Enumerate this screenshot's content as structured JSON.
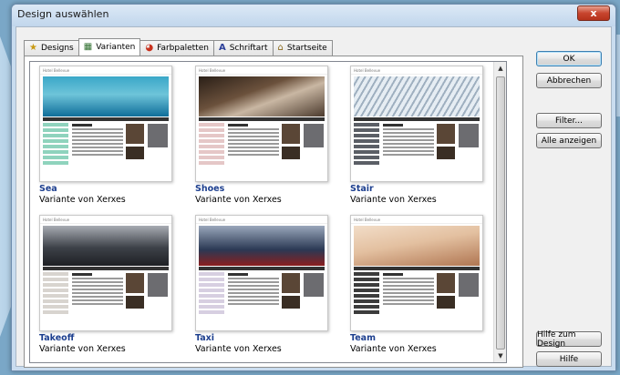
{
  "window": {
    "title": "Design auswählen",
    "close_label": "x"
  },
  "tabs": [
    {
      "label": "Designs",
      "icon": "star-icon",
      "glyph": "★"
    },
    {
      "label": "Varianten",
      "icon": "grid-icon",
      "glyph": "▦"
    },
    {
      "label": "Farbpaletten",
      "icon": "palette-icon",
      "glyph": "◕"
    },
    {
      "label": "Schriftart",
      "icon": "font-icon",
      "glyph": "A"
    },
    {
      "label": "Startseite",
      "icon": "home-icon",
      "glyph": "⌂"
    }
  ],
  "active_tab": "Varianten",
  "variants": [
    {
      "name": "Sea",
      "subtitle": "Variante von Xerxes",
      "header_text": "Hotel Bellevue",
      "hero_color": "#3aa7c8",
      "hero_color2": "#0e6d99",
      "side_color": "#8fd3bd"
    },
    {
      "name": "Shoes",
      "subtitle": "Variante von Xerxes",
      "header_text": "Hotel Bellevue",
      "hero_color": "#4b3a2d",
      "hero_color2": "#c9b7a3",
      "side_color": "#e5c7c7"
    },
    {
      "name": "Stair",
      "subtitle": "Variante von Xerxes",
      "header_text": "Hotel Bellevue",
      "hero_color": "#c7d3de",
      "hero_color2": "#8a9aaa",
      "side_color": "#5b5f66"
    },
    {
      "name": "Takeoff",
      "subtitle": "Variante von Xerxes",
      "header_text": "Hotel Bellevue",
      "hero_color": "#3d4148",
      "hero_color2": "#a8acb3",
      "side_color": "#d8d4cf"
    },
    {
      "name": "Taxi",
      "subtitle": "Variante von Xerxes",
      "header_text": "Hotel Bellevue",
      "hero_color": "#2b3954",
      "hero_color2": "#9aa7bb",
      "side_color": "#d7cfe1"
    },
    {
      "name": "Team",
      "subtitle": "Variante von Xerxes",
      "header_text": "Hotel Bellevue",
      "hero_color": "#e3c0a0",
      "hero_color2": "#b07652",
      "side_color": "#3c3c3c"
    }
  ],
  "buttons": {
    "ok": "OK",
    "cancel": "Abbrechen",
    "filter": "Filter...",
    "show_all": "Alle anzeigen",
    "design_help": "Hilfe zum Design",
    "help": "Hilfe"
  },
  "colors": {
    "title_bar": "#c1d6ec",
    "close_button": "#c7452e",
    "name_colors": [
      "#1d3f8f",
      "#1d3f8f",
      "#1d3f8f",
      "#1d3f8f",
      "#1d3f8f",
      "#1d3f8f"
    ]
  }
}
